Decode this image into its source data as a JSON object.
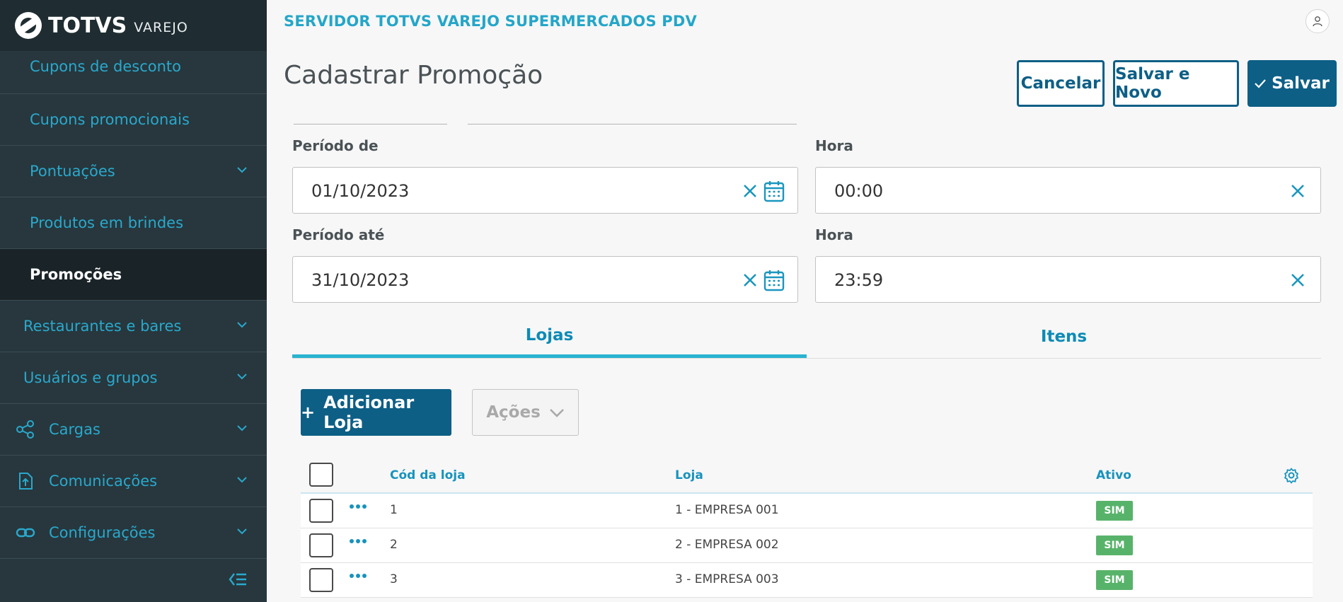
{
  "brand": {
    "name": "TOTVS",
    "product": "VAREJO"
  },
  "header": {
    "app_title": "SERVIDOR TOTVS VAREJO SUPERMERCADOS PDV",
    "page_title": "Cadastrar Promoção"
  },
  "actions": {
    "cancel": "Cancelar",
    "save_new": "Salvar e Novo",
    "save": "Salvar"
  },
  "sidebar": {
    "items": [
      {
        "label": "Cupons de desconto"
      },
      {
        "label": "Cupons promocionais"
      },
      {
        "label": "Pontuações"
      },
      {
        "label": "Produtos em brindes"
      },
      {
        "label": "Promoções"
      },
      {
        "label": "Restaurantes e bares"
      },
      {
        "label": "Usuários e grupos"
      },
      {
        "label": "Cargas"
      },
      {
        "label": "Comunicações"
      },
      {
        "label": "Configurações"
      }
    ]
  },
  "form": {
    "period_from": {
      "label": "Período de",
      "value": "01/10/2023"
    },
    "hour_from": {
      "label": "Hora",
      "value": "00:00"
    },
    "period_to": {
      "label": "Período até",
      "value": "31/10/2023"
    },
    "hour_to": {
      "label": "Hora",
      "value": "23:59"
    }
  },
  "tabs": [
    {
      "label": "Lojas",
      "active": true
    },
    {
      "label": "Itens",
      "active": false
    }
  ],
  "stores": {
    "add_label": "Adicionar Loja",
    "actions_label": "Ações",
    "columns": {
      "code": "Cód da loja",
      "store": "Loja",
      "active": "Ativo"
    },
    "rows": [
      {
        "code": "1",
        "store": "1 - EMPRESA 001",
        "active": "SIM"
      },
      {
        "code": "2",
        "store": "2 - EMPRESA 002",
        "active": "SIM"
      },
      {
        "code": "3",
        "store": "3 - EMPRESA 003",
        "active": "SIM"
      }
    ]
  },
  "colors": {
    "accent": "#24a6c9",
    "primary": "#0d5f86",
    "sidebar_bg": "#27373d",
    "badge_green": "#58b36a"
  }
}
